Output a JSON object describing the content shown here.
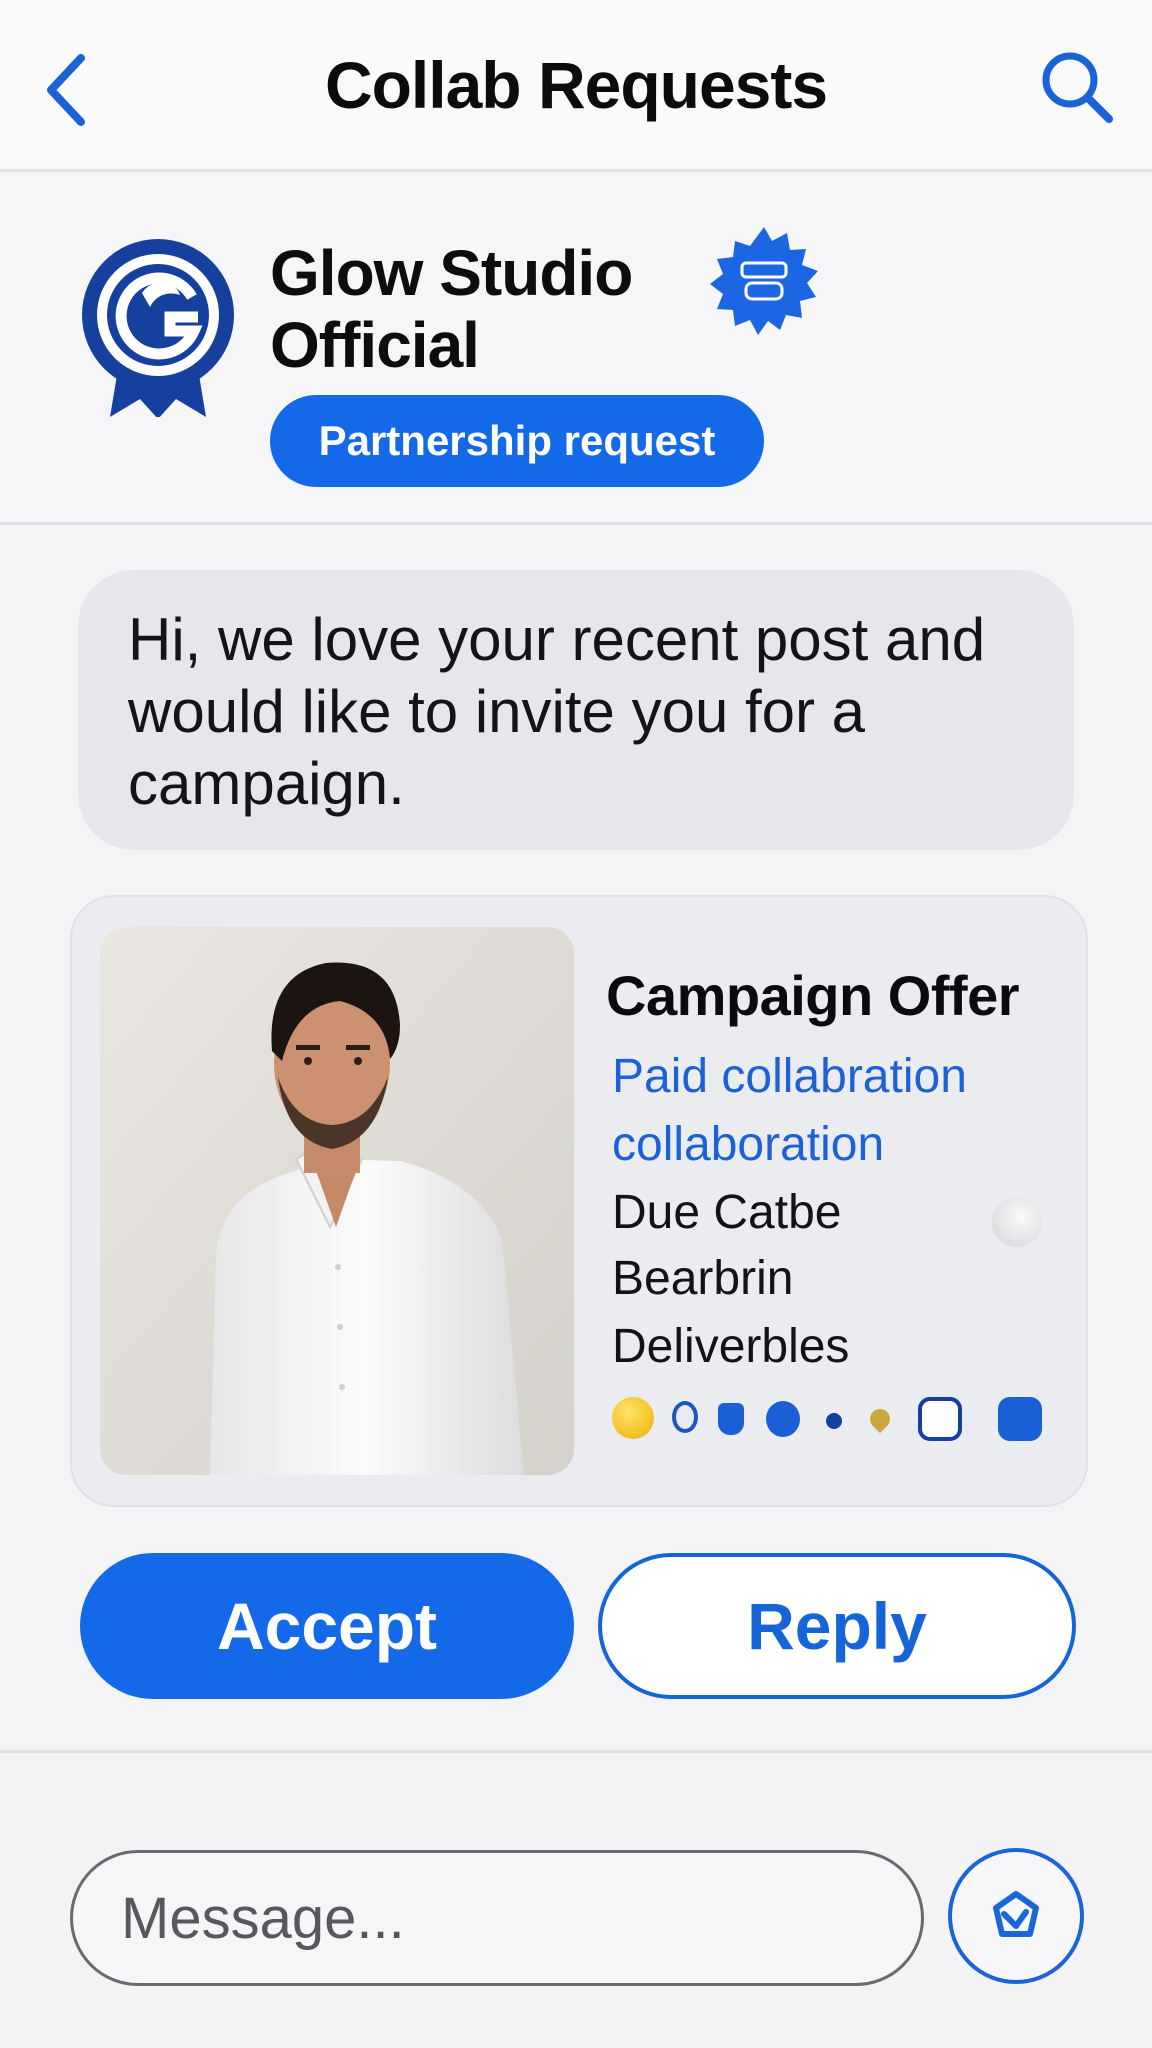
{
  "header": {
    "title": "Collab Requests",
    "back_icon": "chevron-left-icon",
    "search_icon": "search-icon"
  },
  "profile": {
    "name": "Glow Studio Official",
    "badge": "Partnership request",
    "logo_icon": "brand-rosette-logo",
    "verified_icon": "verified-badge-icon"
  },
  "message": {
    "text": "Hi, we love your recent post and would like to invite you for a campaign."
  },
  "offer": {
    "title": "Campaign Offer",
    "lines": [
      "Paid collabration",
      "collaboration",
      "Due Catbe",
      "Bearbrin",
      "Deliverbles"
    ]
  },
  "actions": {
    "accept": "Accept",
    "reply": "Reply"
  },
  "composer": {
    "placeholder": "Message...",
    "send_icon": "send-icon"
  },
  "colors": {
    "accent": "#1469e8",
    "bubble": "#e6e7eb",
    "text": "#111111"
  }
}
